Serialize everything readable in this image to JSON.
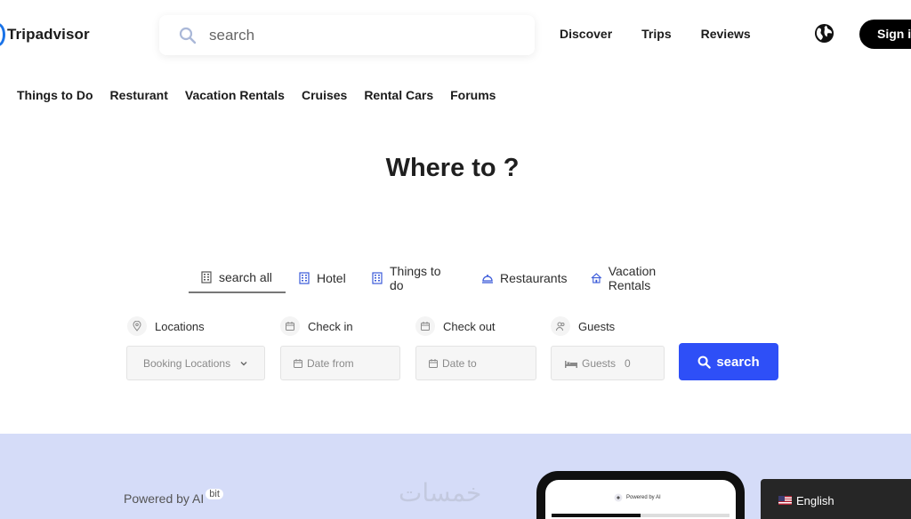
{
  "brand": {
    "name": "Tripadvisor"
  },
  "search": {
    "placeholder": "search"
  },
  "top_nav": [
    "Discover",
    "Trips",
    "Reviews"
  ],
  "sign_in_label": "Sign in",
  "categories": [
    "Things to Do",
    "Resturant",
    "Vacation Rentals",
    "Cruises",
    "Rental Cars",
    "Forums"
  ],
  "hero": {
    "title": "Where to ?"
  },
  "tabs": [
    {
      "label": "search all",
      "icon": "building-icon",
      "active": true
    },
    {
      "label": "Hotel",
      "icon": "building-icon"
    },
    {
      "label": "Things to do",
      "icon": "building-icon"
    },
    {
      "label": "Restaurants",
      "icon": "dish-icon"
    },
    {
      "label": "Vacation Rentals",
      "icon": "house-icon"
    }
  ],
  "form": {
    "locations": {
      "label": "Locations",
      "value": "Booking Locations"
    },
    "check_in": {
      "label": "Check in",
      "placeholder": "Date from"
    },
    "check_out": {
      "label": "Check out",
      "placeholder": "Date to"
    },
    "guests": {
      "label": "Guests",
      "field_label": "Guests",
      "value": "0"
    },
    "submit_label": "search"
  },
  "footer": {
    "powered_by": "Powered by AI",
    "powered_badge": "bit",
    "watermark": "خمسات",
    "phone_text": "Powered by AI"
  },
  "language": {
    "label": "English"
  },
  "colors": {
    "accent": "#2e4ff7",
    "band": "#d5dcf8",
    "dark": "#000000"
  }
}
